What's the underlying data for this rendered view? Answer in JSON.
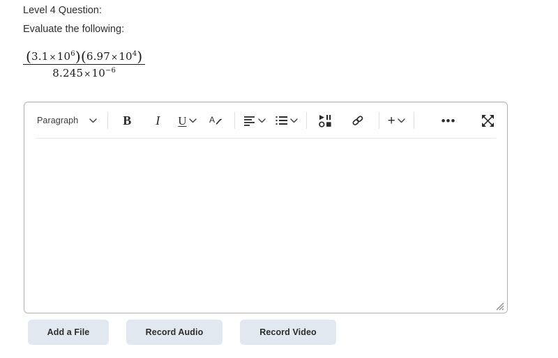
{
  "question": {
    "line1": "Level 4 Question:",
    "line2": "Evaluate the following:",
    "expression": {
      "numerator_plain": "(3.1×10^6)(6.97×10^4)",
      "denominator_plain": "8.245×10^-6",
      "num_factor1_mantissa": "3.1",
      "num_factor1_exponent": "6",
      "num_factor2_mantissa": "6.97",
      "num_factor2_exponent": "4",
      "den_mantissa": "8.245",
      "den_exponent": "−6",
      "base": "10",
      "times_symbol": "×",
      "open_paren": "(",
      "close_paren": ")"
    }
  },
  "editor": {
    "toolbar": {
      "paragraph_label": "Paragraph",
      "bold_label": "B",
      "italic_label": "I",
      "underline_label": "U",
      "text_color_label": "A",
      "plus_label": "+",
      "more_label": "•••",
      "items": [
        {
          "name": "paragraph-style-select",
          "label": "Paragraph",
          "has_chevron": true
        },
        {
          "name": "bold-button",
          "label": "B",
          "has_chevron": false
        },
        {
          "name": "italic-button",
          "label": "I",
          "has_chevron": false
        },
        {
          "name": "underline-button",
          "label": "U",
          "has_chevron": true
        },
        {
          "name": "text-color-button",
          "label": "A",
          "has_chevron": false
        },
        {
          "name": "align-button",
          "label": "Align",
          "has_chevron": true
        },
        {
          "name": "list-button",
          "label": "List",
          "has_chevron": true
        },
        {
          "name": "insert-stuff-button",
          "label": "Insert Stuff",
          "has_chevron": false
        },
        {
          "name": "insert-link-button",
          "label": "Insert Link",
          "has_chevron": false
        },
        {
          "name": "add-button",
          "label": "+",
          "has_chevron": true
        },
        {
          "name": "more-options-button",
          "label": "More",
          "has_chevron": false
        },
        {
          "name": "fullscreen-button",
          "label": "Fullscreen",
          "has_chevron": false
        }
      ]
    },
    "content": "",
    "placeholder": ""
  },
  "actions": {
    "buttons": [
      {
        "label": "Add a File",
        "name": "add-a-file-button"
      },
      {
        "label": "Record Audio",
        "name": "record-audio-button"
      },
      {
        "label": "Record Video",
        "name": "record-video-button"
      }
    ]
  },
  "colors": {
    "page_background": "#ffffff",
    "text": "#2d2d2d",
    "editor_border": "#b0b0b0",
    "toolbar_divider": "#e6e6e6",
    "button_background": "#e2e8f0",
    "icon": "#2b2b2b"
  }
}
